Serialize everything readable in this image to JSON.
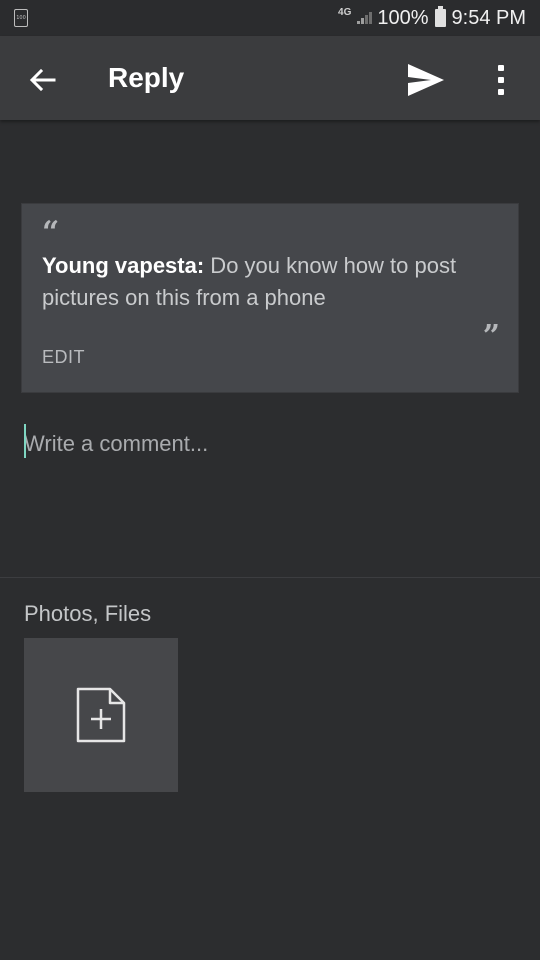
{
  "status_bar": {
    "small_battery_label": "100",
    "network": "4G",
    "battery_percent": "100%",
    "time": "9:54 PM"
  },
  "toolbar": {
    "title": "Reply",
    "back_icon": "arrow-left-icon",
    "send_icon": "send-icon",
    "more_icon": "more-vert-icon"
  },
  "quote": {
    "open_mark": "“",
    "author": "Young vapesta:",
    "text": " Do you know how to post pictures on this from a phone",
    "close_mark": "”",
    "edit_label": "EDIT"
  },
  "comment": {
    "placeholder": "Write a comment...",
    "value": ""
  },
  "attachments": {
    "label": "Photos, Files",
    "add_icon": "add-file-icon"
  },
  "colors": {
    "background": "#2c2d2f",
    "toolbar": "#3b3c3e",
    "card": "#45474b",
    "accent_caret": "#7fd6c2"
  }
}
